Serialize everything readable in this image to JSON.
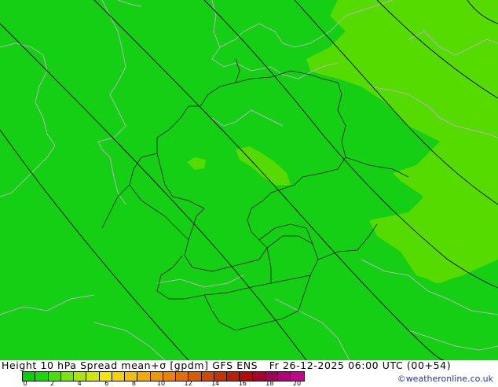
{
  "map": {
    "background_color": "#14cf14",
    "highlight_color": "#55db00",
    "isobar_color": "#000000",
    "border_color": "#000000",
    "coast_color": "#b4b4b4"
  },
  "title": {
    "product": "Height 10 hPa Spread mean+σ [gpdm]",
    "model": "GFS ENS",
    "valid_time": "Fr 26-12-2025 06:00 UTC (00+54)"
  },
  "legend": {
    "tick_labels": [
      "0",
      "2",
      "4",
      "6",
      "8",
      "10",
      "12",
      "14",
      "16",
      "18",
      "20"
    ],
    "swatch_colors": [
      "#00d200",
      "#14dc00",
      "#46e100",
      "#78e600",
      "#aae600",
      "#d2e600",
      "#f0e600",
      "#f5d200",
      "#f5be00",
      "#f5aa00",
      "#f09600",
      "#eb8200",
      "#e66e00",
      "#dc5a00",
      "#d24600",
      "#c83200",
      "#be1e00",
      "#b40a00",
      "#aa0028",
      "#a0005a",
      "#b40078",
      "#c8008c"
    ]
  },
  "credit": "©weatheronline.co.uk"
}
